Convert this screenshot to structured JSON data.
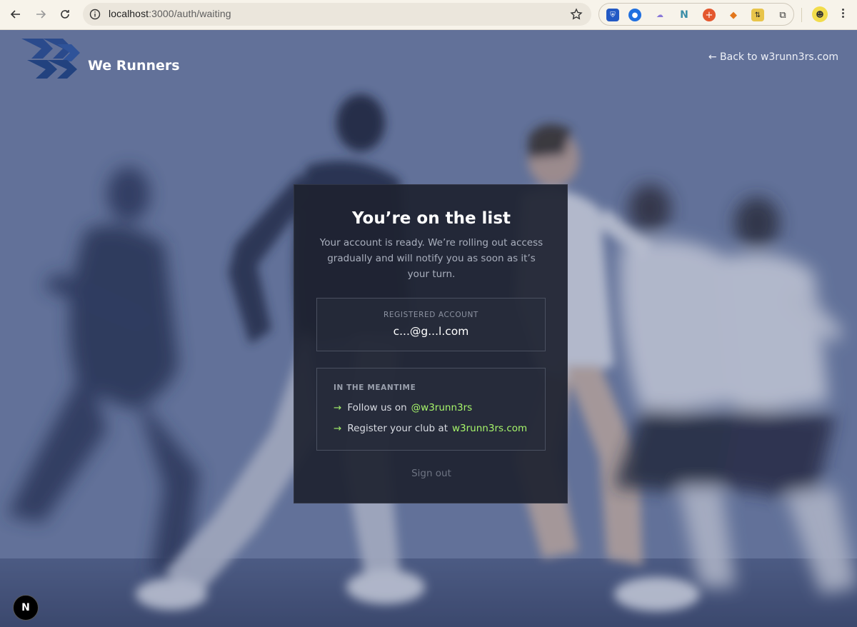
{
  "browser": {
    "url_host": "localhost",
    "url_path": ":3000/auth/waiting",
    "icons": [
      "back-arrow-icon",
      "forward-arrow-icon",
      "reload-icon",
      "site-info-icon",
      "bookmark-star-icon",
      "extensions-puzzle-icon",
      "chrome-menu-icon"
    ]
  },
  "header": {
    "brand_name": "We Runners",
    "back_link": "← Back to w3runn3rs.com"
  },
  "card": {
    "title": "You’re on the list",
    "description": "Your account is ready. We’re rolling out access gradually and will notify you as soon as it’s your turn.",
    "registered_label": "REGISTERED ACCOUNT",
    "registered_email": "c...@g...l.com",
    "meantime_title": "IN THE MEANTIME",
    "items": [
      {
        "arrow": "→",
        "text": "Follow us on",
        "link": "@w3runn3rs"
      },
      {
        "arrow": "→",
        "text": "Register your club at",
        "link": "w3runn3rs.com"
      }
    ],
    "sign_out": "Sign out"
  },
  "dev_badge": "N",
  "colors": {
    "accent_green": "#a6f56a",
    "card_bg": "#1e2230",
    "brand_blue": "#23407a"
  }
}
